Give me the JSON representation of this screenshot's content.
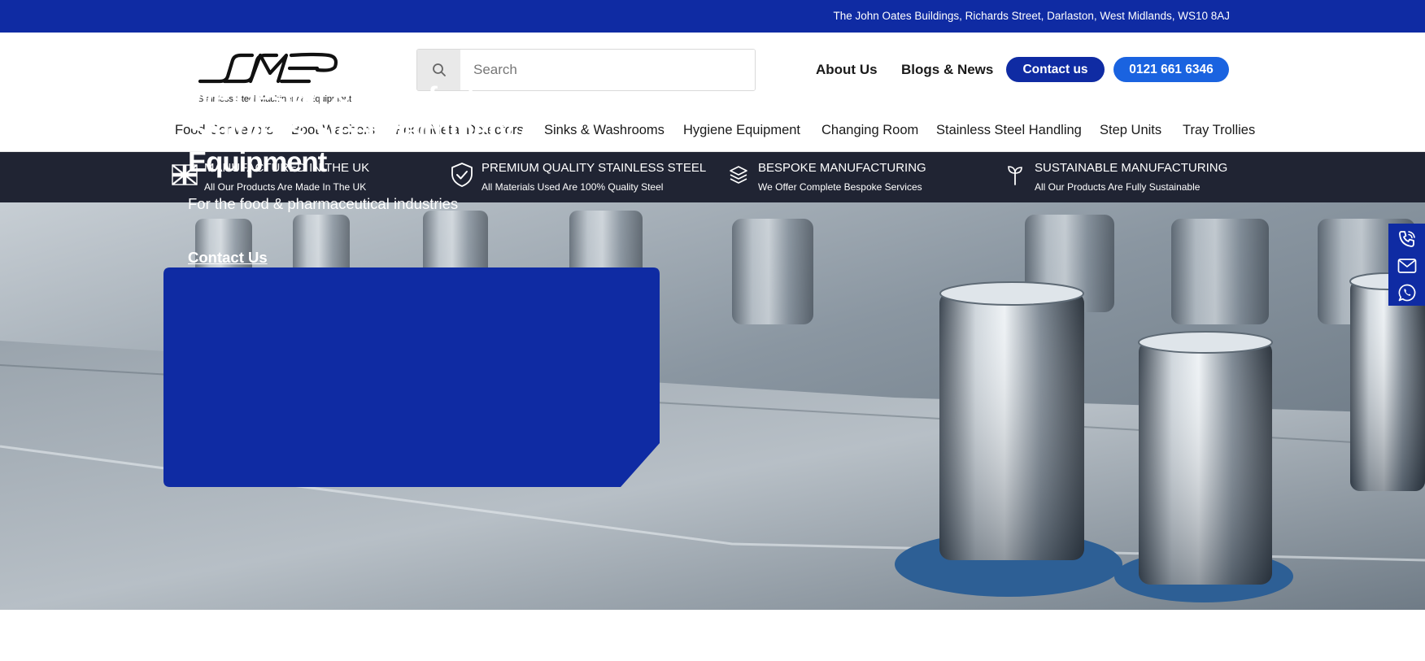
{
  "topbar": {
    "address": "The John Oates Buildings, Richards Street, Darlaston, West Midlands, WS10 8AJ"
  },
  "header": {
    "logo_text": "SSME",
    "logo_tagline": "Stainless Steel Machinery & Equipment",
    "search": {
      "placeholder": "Search",
      "value": ""
    },
    "links": {
      "about": "About Us",
      "blogs": "Blogs & News"
    },
    "contact_button": "Contact us",
    "phone_button": "0121 661 6346"
  },
  "nav": {
    "items": [
      "Food Conveyors",
      "Boot Washers",
      "Food Metal Detectors",
      "Sinks & Washrooms",
      "Hygiene Equipment",
      "Changing Room",
      "Stainless Steel Handling",
      "Step Units",
      "Tray Trollies"
    ]
  },
  "usp": [
    {
      "icon": "uk-flag-icon",
      "title": "MANUFACTURED IN THE UK",
      "subtitle": "All Our Products Are Made In The UK"
    },
    {
      "icon": "shield-check-icon",
      "title": "PREMIUM QUALITY STAINLESS STEEL",
      "subtitle": "All Materials Used Are 100% Quality Steel"
    },
    {
      "icon": "layers-icon",
      "title": "BESPOKE MANUFACTURING",
      "subtitle": "We Offer Complete Bespoke Services"
    },
    {
      "icon": "sprout-icon",
      "title": "SUSTAINABLE MANUFACTURING",
      "subtitle": "All Our Products Are Fully Sustainable"
    }
  ],
  "hero": {
    "title": "We Design & Manufacture Stainless Steel Machinery & Equipment",
    "subtitle": "For the food & pharmaceutical industries",
    "cta": "Contact Us"
  },
  "sidebar": {
    "icons": [
      "phone-icon",
      "email-icon",
      "whatsapp-icon"
    ]
  },
  "colors": {
    "brand_blue": "#0f2ba3",
    "accent_blue": "#1a63e0",
    "dark_strip": "#202433"
  }
}
